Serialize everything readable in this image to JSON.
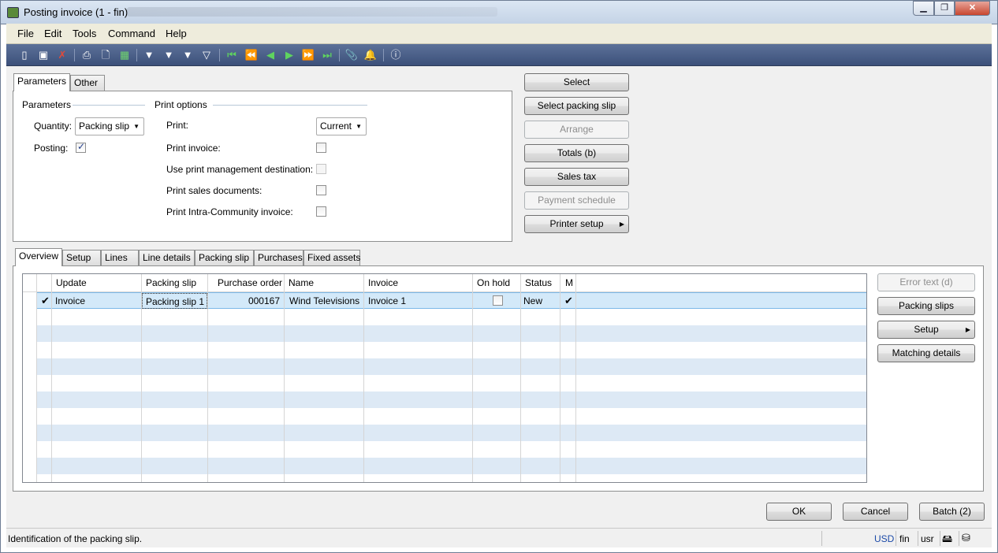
{
  "window": {
    "title": "Posting invoice (1 - fin)",
    "controls": {
      "minimize": "▁",
      "maximize": "❐",
      "close": "✕"
    }
  },
  "menu": [
    "File",
    "Edit",
    "Tools",
    "Command",
    "Help"
  ],
  "toolbar_icons": [
    "new-icon",
    "save-icon",
    "delete-icon",
    "print-icon",
    "print-preview-icon",
    "excel-icon",
    "filter-by-selection-icon",
    "filter-by-grid-icon",
    "advanced-filter-icon",
    "remove-filter-icon",
    "first-record-icon",
    "previous-page-icon",
    "previous-record-icon",
    "next-record-icon",
    "next-page-icon",
    "last-record-icon",
    "document-handling-icon",
    "alert-icon",
    "help-icon"
  ],
  "top_tabs": {
    "parameters": "Parameters",
    "other": "Other"
  },
  "parameters": {
    "group_title": "Parameters",
    "quantity_label": "Quantity:",
    "quantity_value": "Packing slip",
    "posting_label": "Posting:",
    "posting_checked": true
  },
  "print_options": {
    "group_title": "Print options",
    "print_label": "Print:",
    "print_value": "Current",
    "print_invoice_label": "Print invoice:",
    "use_print_mgmt_label": "Use print management destination:",
    "print_sales_docs_label": "Print sales documents:",
    "print_intra_label": "Print Intra-Community invoice:"
  },
  "side_buttons": {
    "select": "Select",
    "select_packing_slip": "Select packing slip",
    "arrange": "Arrange",
    "totals": "Totals (b)",
    "sales_tax": "Sales tax",
    "payment_schedule": "Payment schedule",
    "printer_setup": "Printer setup"
  },
  "lower_tabs": {
    "overview": "Overview",
    "setup": "Setup",
    "lines": "Lines",
    "line_details": "Line details",
    "packing_slip": "Packing slip",
    "purchases": "Purchases",
    "fixed_assets": "Fixed assets"
  },
  "grid": {
    "columns": {
      "update": "Update",
      "packing_slip": "Packing slip",
      "purchase_order": "Purchase order",
      "name": "Name",
      "invoice": "Invoice",
      "on_hold": "On hold",
      "status": "Status",
      "m": "M"
    },
    "row": {
      "update": "Invoice",
      "packing_slip": "Packing slip 1",
      "purchase_order": "000167",
      "name": "Wind Televisions",
      "invoice": "Invoice 1",
      "on_hold": false,
      "status": "New"
    }
  },
  "grid_buttons": {
    "error_text": "Error text (d)",
    "packing_slips": "Packing slips",
    "setup": "Setup",
    "matching_details": "Matching details"
  },
  "footer_buttons": {
    "ok": "OK",
    "cancel": "Cancel",
    "batch": "Batch (2)"
  },
  "statusbar": {
    "help_text": "Identification of the packing slip.",
    "currency": "USD",
    "company": "fin",
    "user": "usr"
  }
}
